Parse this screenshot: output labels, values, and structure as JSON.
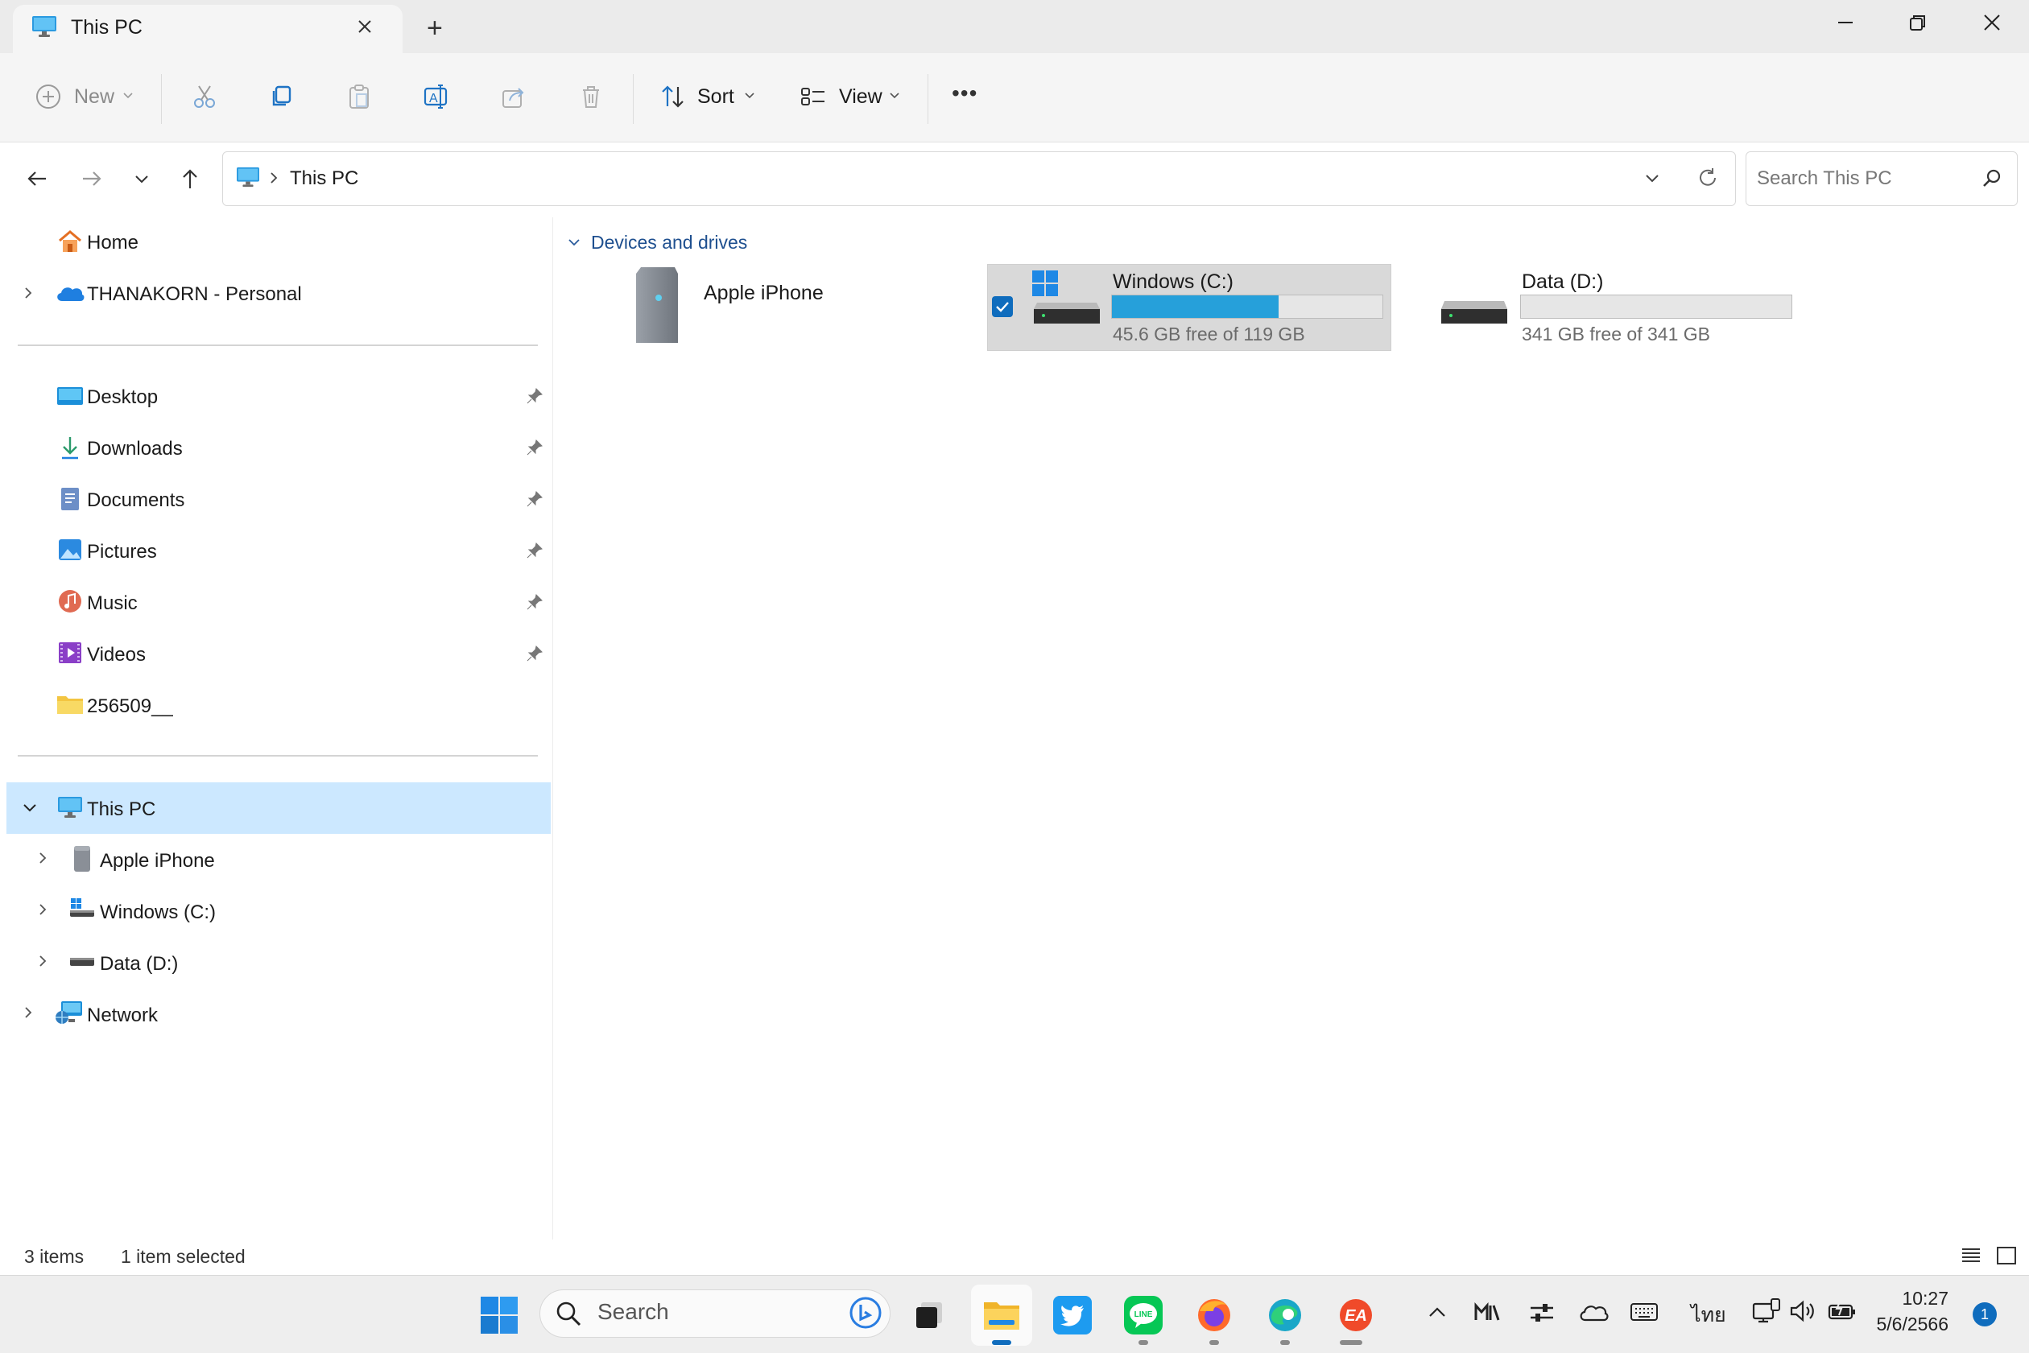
{
  "window": {
    "tab_title": "This PC",
    "new_tab_symbol": "+"
  },
  "toolbar": {
    "new_label": "New",
    "sort_label": "Sort",
    "view_label": "View",
    "more_label": "•••"
  },
  "address": {
    "location": "This PC",
    "search_placeholder": "Search This PC"
  },
  "navpane": {
    "home": "Home",
    "onedrive": "THANAKORN - Personal",
    "quick_access": [
      {
        "label": "Desktop",
        "icon": "desktop-icon"
      },
      {
        "label": "Downloads",
        "icon": "downloads-icon"
      },
      {
        "label": "Documents",
        "icon": "documents-icon"
      },
      {
        "label": "Pictures",
        "icon": "pictures-icon"
      },
      {
        "label": "Music",
        "icon": "music-icon"
      },
      {
        "label": "Videos",
        "icon": "videos-icon"
      },
      {
        "label": "256509__",
        "icon": "folder-icon"
      }
    ],
    "this_pc": "This PC",
    "this_pc_children": [
      "Apple iPhone",
      "Windows (C:)",
      "Data (D:)"
    ],
    "network": "Network"
  },
  "content": {
    "group_header": "Devices and drives",
    "devices": [
      {
        "name": "Apple iPhone"
      },
      {
        "name": "Windows (C:)",
        "free_text": "45.6 GB free of 119 GB",
        "used_fraction": 0.617,
        "selected": true
      },
      {
        "name": "Data (D:)",
        "free_text": "341 GB free of 341 GB",
        "used_fraction": 0.0,
        "selected": false
      }
    ]
  },
  "status": {
    "items": "3 items",
    "selected": "1 item selected"
  },
  "taskbar": {
    "search_label": "Search",
    "tray_language": "ไทย",
    "time": "10:27",
    "date": "5/6/2566",
    "notification_count": "1"
  },
  "colors": {
    "accent": "#0f6cbd",
    "drive_bar": "#26a0da",
    "selection_bg": "#cce8ff",
    "selected_tile_bg": "#d9d9d9"
  }
}
